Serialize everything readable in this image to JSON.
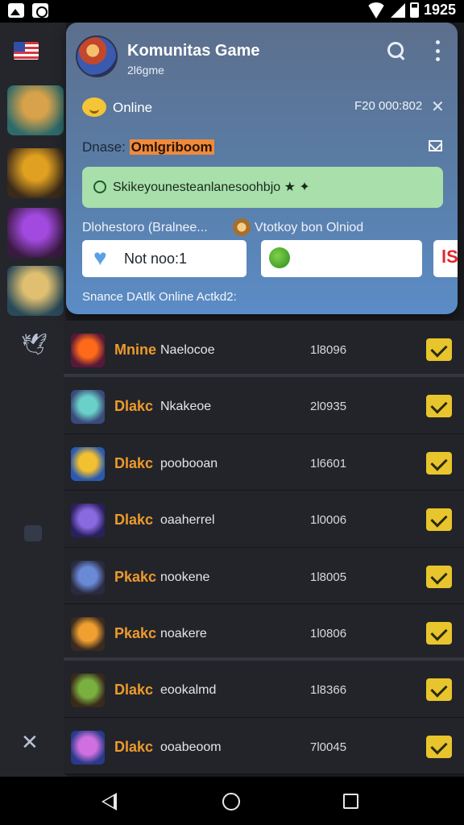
{
  "status_bar": {
    "time": "1925"
  },
  "header": {
    "title": "Komunitas Game",
    "subtitle": "2l6gme"
  },
  "card": {
    "online_label": "Online",
    "stat_code": "F20 000:802",
    "name_label": "Dnase:",
    "name_highlight": "Omlgriboom",
    "banner_text": "Skikeyounesteanlanesoohbjo ★ ✦",
    "section_left": "Dlohestoro (Bralnee...",
    "section_right": "Vtotkoy bon Olniod",
    "box1_text": "Not noo:1",
    "box3_text": "lS",
    "footer_text": "Snance DAtlk Online Actkd2:"
  },
  "list": [
    {
      "title": "Mnine",
      "subtitle": "Naelocoe",
      "value": "1l8096",
      "checked": true,
      "thumb_colors": [
        "#ff6a1a",
        "#5a1838"
      ]
    },
    {
      "title": "Dlakc",
      "subtitle": "Nkakeoe",
      "value": "2l0935",
      "checked": true,
      "thumb_colors": [
        "#6ad0c8",
        "#3a4a7a"
      ]
    },
    {
      "title": "Dlakc",
      "subtitle": "poobooan",
      "value": "1l6601",
      "checked": true,
      "thumb_colors": [
        "#f2c030",
        "#2a5ab0"
      ]
    },
    {
      "title": "Dlakc",
      "subtitle": "oaaherrel",
      "value": "1l0006",
      "checked": true,
      "thumb_colors": [
        "#8a6ae0",
        "#2a2060"
      ]
    },
    {
      "title": "Pkakc",
      "subtitle": "nookene",
      "value": "1l8005",
      "checked": true,
      "thumb_colors": [
        "#6a8ad8",
        "#2a2a40"
      ]
    },
    {
      "title": "Pkakc",
      "subtitle": "noakere",
      "value": "1l0806",
      "checked": true,
      "thumb_colors": [
        "#f0a030",
        "#3a2a20"
      ]
    },
    {
      "title": "Dlakc",
      "subtitle": "eookalmd",
      "value": "1l8366",
      "checked": true,
      "thumb_colors": [
        "#7ab040",
        "#3a2a1a"
      ]
    },
    {
      "title": "Dlakc",
      "subtitle": "ooabeoom",
      "value": "7l0045",
      "checked": true,
      "thumb_colors": [
        "#d070e0",
        "#2a3a8a"
      ]
    }
  ],
  "sidebar": {
    "thumb_colors": [
      [
        "#d8a24a",
        "#2e6a6a"
      ],
      [
        "#e0a020",
        "#3a2a1a"
      ],
      [
        "#a24ae0",
        "#3a1a40"
      ],
      [
        "#e0c070",
        "#2a4a5a"
      ]
    ]
  }
}
